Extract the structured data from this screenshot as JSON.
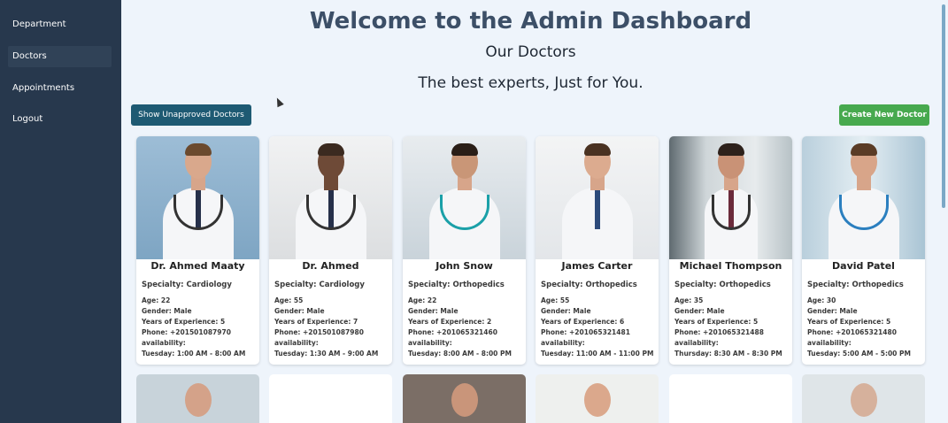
{
  "sidebar": {
    "items": [
      {
        "label": "Department"
      },
      {
        "label": "Doctors"
      },
      {
        "label": "Appointments"
      },
      {
        "label": "Logout"
      }
    ],
    "active": "Doctors"
  },
  "header": {
    "title": "Welcome to the Admin Dashboard",
    "subtitle": "Our Doctors",
    "tagline": "The best experts, Just for You."
  },
  "toolbar": {
    "unapproved_label": "Show Unapproved Doctors",
    "create_label": "Create New Doctor"
  },
  "doctors": [
    {
      "name": "Dr. Ahmed Maaty",
      "specialty": "Specialty: Cardiology",
      "age": "Age: 22",
      "gender": "Gender: Male",
      "experience": "Years of Experience: 5",
      "phone": "Phone: +201501087970",
      "availability_label": "availability:",
      "availability": "Tuesday: 1:00 AM - 8:00 AM"
    },
    {
      "name": "Dr. Ahmed",
      "specialty": "Specialty: Cardiology",
      "age": "Age: 55",
      "gender": "Gender: Male",
      "experience": "Years of Experience: 7",
      "phone": "Phone: +201501087980",
      "availability_label": "availability:",
      "availability": "Tuesday: 1:30 AM - 9:00 AM"
    },
    {
      "name": "John Snow",
      "specialty": "Specialty: Orthopedics",
      "age": "Age: 22",
      "gender": "Gender: Male",
      "experience": "Years of Experience: 2",
      "phone": "Phone: +201065321460",
      "availability_label": "availability:",
      "availability": "Tuesday: 8:00 AM - 8:00 PM"
    },
    {
      "name": "James Carter",
      "specialty": "Specialty: Orthopedics",
      "age": "Age: 55",
      "gender": "Gender: Male",
      "experience": "Years of Experience: 6",
      "phone": "Phone: +201065321481",
      "availability_label": "availability:",
      "availability": "Tuesday: 11:00 AM - 11:00 PM"
    },
    {
      "name": "Michael Thompson",
      "specialty": "Specialty: Orthopedics",
      "age": "Age: 35",
      "gender": "Gender: Male",
      "experience": "Years of Experience: 5",
      "phone": "Phone: +201065321488",
      "availability_label": "availability:",
      "availability": "Thursday: 8:30 AM - 8:30 PM"
    },
    {
      "name": "David Patel",
      "specialty": "Specialty: Orthopedics",
      "age": "Age: 30",
      "gender": "Gender: Male",
      "experience": "Years of Experience: 5",
      "phone": "Phone: +201065321480",
      "availability_label": "availability:",
      "availability": "Tuesday: 5:00 AM - 5:00 PM"
    }
  ],
  "colors": {
    "sidebar_bg": "#27384d",
    "title": "#3c4f67",
    "unapproved_button": "#1e5a73",
    "create_button": "#47a94e",
    "page_bg": "#eef4fb"
  }
}
